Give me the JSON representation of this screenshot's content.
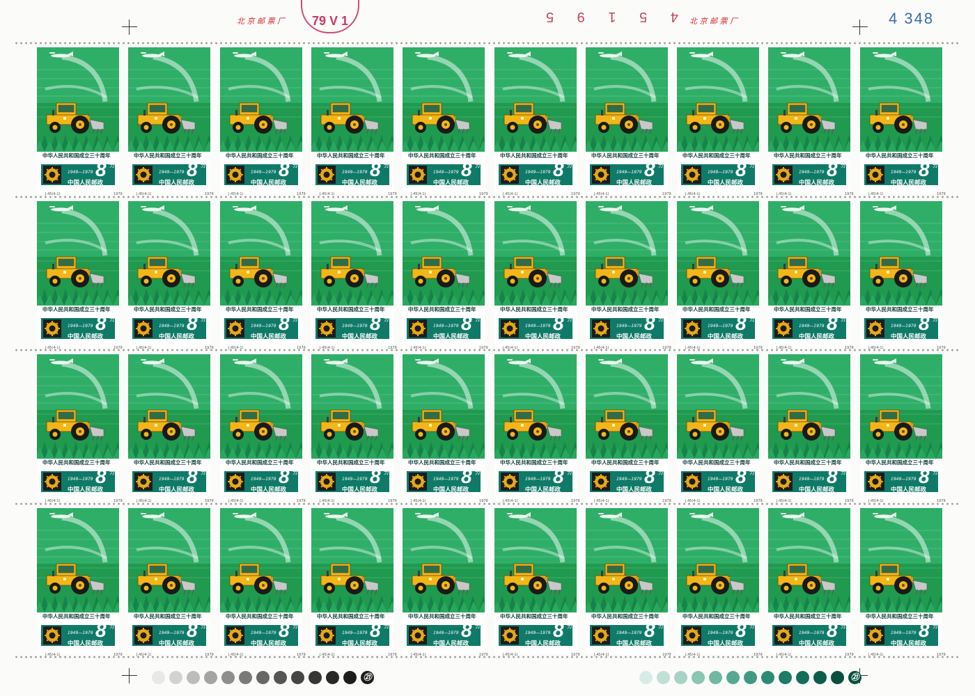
{
  "sheet": {
    "printer_mark_left": "北 京 邮 票 厂",
    "printer_mark_right": "北 京 邮 票 厂",
    "date_stamp": "79 V 1",
    "serial_number": "4 5 1 9 5",
    "sheet_number": "4 348",
    "rows": 4,
    "columns": 10
  },
  "stamp": {
    "caption": "中华人民共和国成立三十周年",
    "years": "1949—1979",
    "country": "中国人民邮政",
    "denomination": "8",
    "denomination_unit": "分",
    "catalog_code": "J.45(4-1)",
    "issue_year": "1979"
  },
  "colors": {
    "field_green": "#1f9a4f",
    "sky_green": "#2fae68",
    "panel_teal": "#0f7a68",
    "tractor_yellow": "#f2b619",
    "wheel_black": "#1a1a1a",
    "spray_white": "#e9f6ee",
    "serial_red": "#c4455b",
    "sheet_number_blue": "#3b6aa8",
    "printer_red": "#cc2a2a"
  },
  "color_bars": {
    "left_label": "㉑",
    "right_label": "㉑",
    "left_shades": [
      "#e8e8e8",
      "#d2d2d2",
      "#bcbcbc",
      "#a4a4a4",
      "#8e8e8e",
      "#7a7a7a",
      "#676767",
      "#555555",
      "#454545",
      "#363636",
      "#282828",
      "#1c1c1c"
    ],
    "right_shades": [
      "#d7ece6",
      "#bfe0d6",
      "#a6d3c6",
      "#8bc5b4",
      "#71b7a2",
      "#57a892",
      "#3f9a82",
      "#2c8b73",
      "#1e7b64",
      "#146d57",
      "#0c5e4a",
      "#084f3e"
    ]
  }
}
